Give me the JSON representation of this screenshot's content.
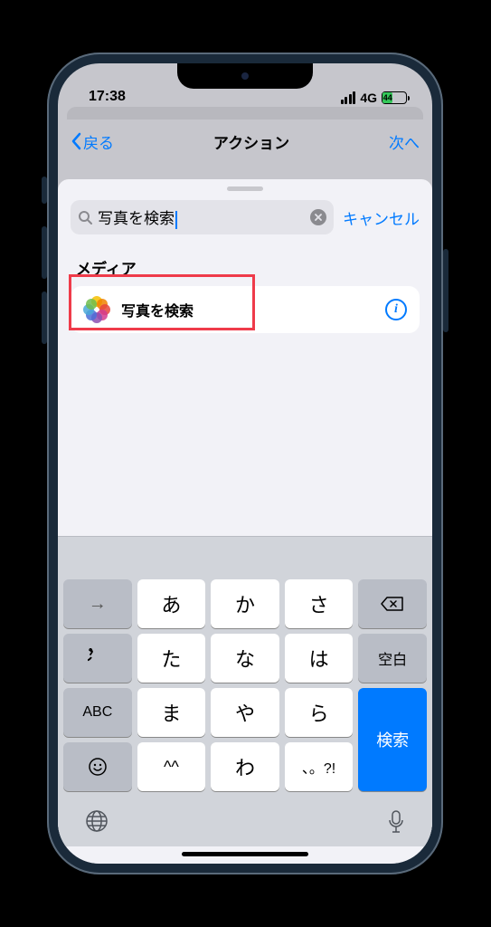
{
  "status": {
    "time": "17:38",
    "network": "4G",
    "battery_pct": "44"
  },
  "nav": {
    "back": "戻る",
    "title": "アクション",
    "next": "次へ"
  },
  "search": {
    "value": "写真を検索",
    "cancel": "キャンセル"
  },
  "section": {
    "media": "メディア"
  },
  "action": {
    "find_photos": "写真を検索"
  },
  "keyboard": {
    "rows": [
      [
        "→",
        "あ",
        "か",
        "さ",
        "⌫"
      ],
      [
        "↺",
        "た",
        "な",
        "は",
        "空白"
      ],
      [
        "ABC",
        "ま",
        "や",
        "ら",
        "検索"
      ],
      [
        "☺",
        "^^",
        "わ",
        "、。?!",
        ""
      ]
    ],
    "search_key": "検索",
    "space_key": "空白",
    "abc_key": "ABC"
  }
}
